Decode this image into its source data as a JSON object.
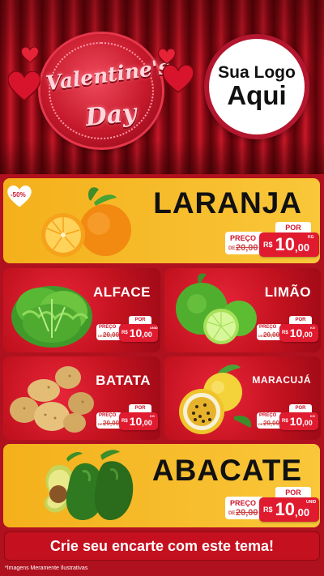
{
  "header": {
    "valentine_title": "Valentine's",
    "valentine_day": "Day",
    "logo_line1": "Sua Logo",
    "logo_line2": "Aqui"
  },
  "badge": {
    "text": "-50%"
  },
  "products": {
    "laranja": {
      "name": "LARANJA",
      "por": "POR",
      "preco": "PREÇO",
      "de": "DE",
      "old_price": "20,00",
      "currency": "R$",
      "price_int": "10",
      "price_dec": ",00",
      "unit": "KG"
    },
    "alface": {
      "name": "ALFACE",
      "por": "POR",
      "preco": "PREÇO",
      "de": "DE",
      "old_price": "20,00",
      "currency": "R$",
      "price_int": "10",
      "price_dec": ",00",
      "unit": "UNID"
    },
    "limao": {
      "name": "LIMÃO",
      "por": "POR",
      "preco": "PREÇO",
      "de": "DE",
      "old_price": "20,00",
      "currency": "R$",
      "price_int": "10",
      "price_dec": ",00",
      "unit": "KG"
    },
    "batata": {
      "name": "BATATA",
      "por": "POR",
      "preco": "PREÇO",
      "de": "DE",
      "old_price": "20,00",
      "currency": "R$",
      "price_int": "10",
      "price_dec": ",00",
      "unit": "KG"
    },
    "maracuja": {
      "name": "MARACUJÁ",
      "por": "POR",
      "preco": "PREÇO",
      "de": "DE",
      "old_price": "20,00",
      "currency": "R$",
      "price_int": "10",
      "price_dec": ",00",
      "unit": "KG"
    },
    "abacate": {
      "name": "ABACATE",
      "por": "POR",
      "preco": "PREÇO",
      "de": "DE",
      "old_price": "20,00",
      "currency": "R$",
      "price_int": "10",
      "price_dec": ",00",
      "unit": "UNID"
    }
  },
  "footer": {
    "cta": "Crie seu encarte com este tema!",
    "disclaimer": "*Imagens Meramente Ilustrativas"
  },
  "colors": {
    "red": "#c5101f",
    "yellow": "#f4b01b",
    "price_red": "#e01a2f"
  }
}
